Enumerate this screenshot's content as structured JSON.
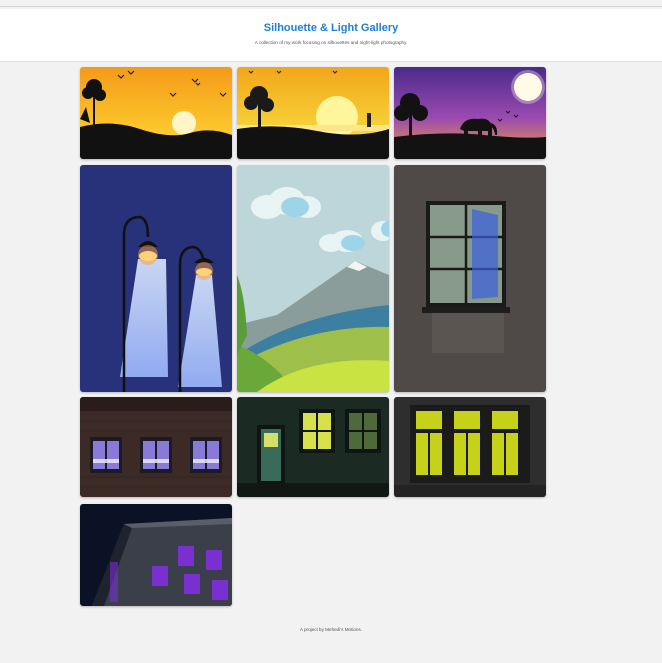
{
  "header": {
    "title": "Silhouette & Light Gallery",
    "subtitle": "A collection of my work focusing on silhouettes and night-light photography."
  },
  "gallery": [
    {
      "icon": "sunset-with-birds-tree"
    },
    {
      "icon": "sunrise-tree-silhouette"
    },
    {
      "icon": "elephant-moonlight"
    },
    {
      "icon": "street-lamps"
    },
    {
      "icon": "mountains-landscape"
    },
    {
      "icon": "lit-window-wall"
    },
    {
      "icon": "brick-building-windows"
    },
    {
      "icon": "green-house-door"
    },
    {
      "icon": "dark-wall-yellow-windows"
    },
    {
      "icon": "night-building-purple-windows"
    }
  ],
  "footer": {
    "text": "A project by Mehedi's Motions."
  },
  "colors": {
    "accent": "#1e7fd6",
    "background": "#f2f2f2"
  }
}
